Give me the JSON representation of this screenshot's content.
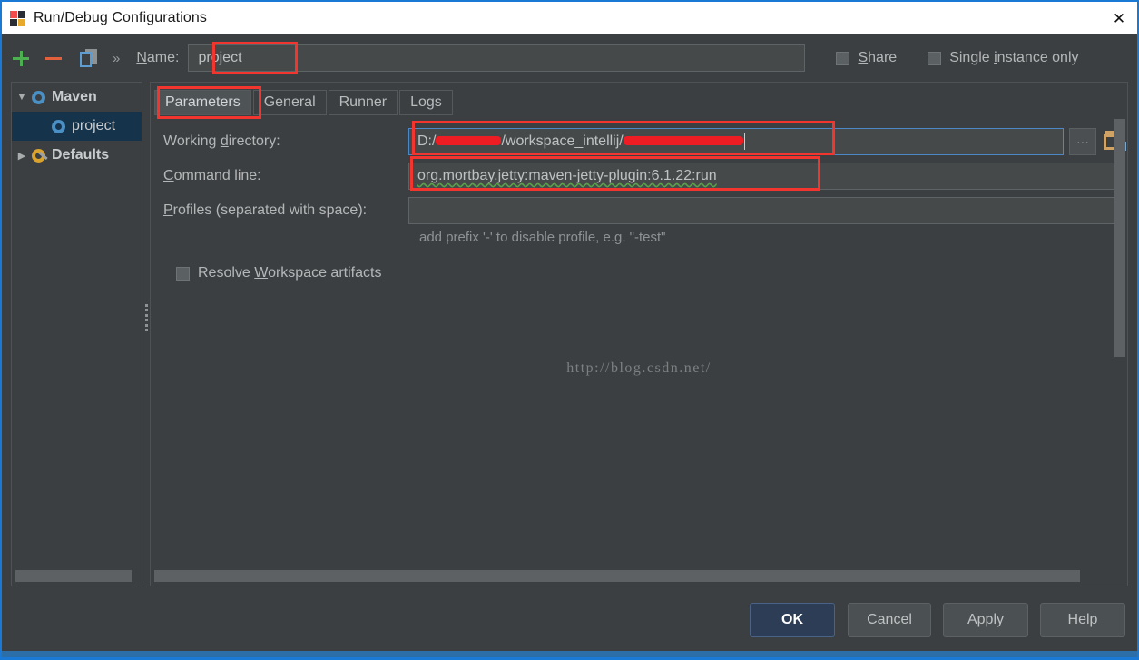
{
  "window": {
    "title": "Run/Debug Configurations",
    "close_label": "✕",
    "accent_color": "#1a79d4",
    "background_color": "#3c3f41"
  },
  "toolbar": {
    "add_label": "+",
    "remove_label": "−",
    "copy_label": "copy",
    "more_label": "»",
    "name_label_pre": "",
    "name_label_accel": "N",
    "name_label_post": "ame:",
    "name_value": "project",
    "share_accel": "S",
    "share_label_post": "hare",
    "single_instance_pre": "Single ",
    "single_instance_accel": "i",
    "single_instance_post": "nstance only",
    "share_checked": false,
    "single_instance_checked": false
  },
  "tree": {
    "items": [
      {
        "label": "Maven",
        "expanded": true,
        "triangle": "▼",
        "icon": "gear-icon",
        "selected": false,
        "indent": 0,
        "bold": true
      },
      {
        "label": "project",
        "expanded": false,
        "triangle": "",
        "icon": "gear-icon",
        "selected": true,
        "indent": 1,
        "bold": false
      },
      {
        "label": "Defaults",
        "expanded": false,
        "triangle": "▶",
        "icon": "gear-wrench-icon",
        "selected": false,
        "indent": 0,
        "bold": true
      }
    ]
  },
  "tabs": [
    {
      "label": "Parameters",
      "active": true
    },
    {
      "label": "General",
      "active": false
    },
    {
      "label": "Runner",
      "active": false
    },
    {
      "label": "Logs",
      "active": false
    }
  ],
  "form": {
    "working_directory": {
      "label_pre": "Working ",
      "label_accel": "d",
      "label_post": "irectory:",
      "value_part1": "D:/",
      "value_part2": "/workspace_intellij/",
      "redacted": true
    },
    "command_line": {
      "label_accel": "C",
      "label_post": "ommand line:",
      "value": "org.mortbay.jetty:maven-jetty-plugin:6.1.22:run"
    },
    "profiles": {
      "label_accel": "P",
      "label_post": "rofiles (separated with space):",
      "value": "",
      "hint": "add prefix '-' to disable profile, e.g. \"-test\""
    },
    "resolve_workspace": {
      "label_pre": "Resolve ",
      "label_accel": "W",
      "label_post": "orkspace artifacts",
      "checked": false
    },
    "browse_button_label": "···"
  },
  "watermark": "http://blog.csdn.net/",
  "footer": {
    "ok": "OK",
    "cancel": "Cancel",
    "apply": "Apply",
    "help": "Help"
  },
  "highlights": {
    "color": "#f2352e",
    "targets": [
      "name-field",
      "parameters-tab",
      "working-directory-field",
      "command-line-field"
    ]
  }
}
